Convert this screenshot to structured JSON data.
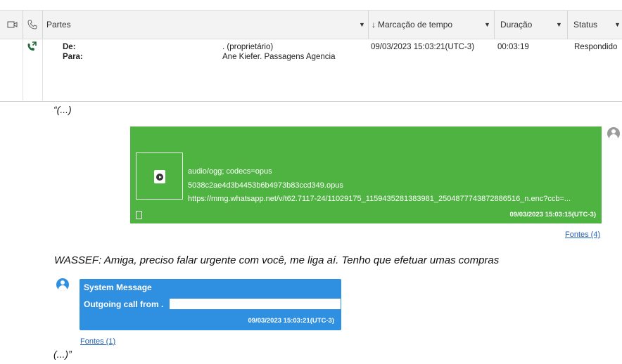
{
  "grid": {
    "columns": {
      "partes": "Partes",
      "marcacao": "Marcação de tempo",
      "duracao": "Duração",
      "status": "Status"
    },
    "row": {
      "de_label": "De:",
      "para_label": "Para:",
      "de_value": ". (proprietário)",
      "para_value": "Ane Kiefer. Passagens Agencia",
      "timestamp": "09/03/2023 15:03:21(UTC-3)",
      "duration": "00:03:19",
      "status": "Respondido"
    }
  },
  "quote_open": "“(...)",
  "audio_message": {
    "mime": "audio/ogg; codecs=opus",
    "filename": "5038c2ae4d3b4453b6b4973b83ccd349.opus",
    "url": "https://mmg.whatsapp.net/v/t62.7117-24/11029175_1159435281383981_2504877743872886516_n.enc?ccb=...",
    "timestamp": "09/03/2023 15:03:15(UTC-3)",
    "sources_link": "Fontes (4)"
  },
  "transcript": "WASSEF: Amiga, preciso falar urgente com você, me liga aí. Tenho que efetuar umas compras",
  "system_message": {
    "title": "System Message",
    "body": "Outgoing call from .",
    "timestamp": "09/03/2023 15:03:21(UTC-3)",
    "sources_link": "Fontes (1)"
  },
  "quote_close": "(...)”",
  "colors": {
    "green_bubble": "#4fb342",
    "blue_bubble": "#2f8fe0",
    "link": "#2262b7"
  }
}
